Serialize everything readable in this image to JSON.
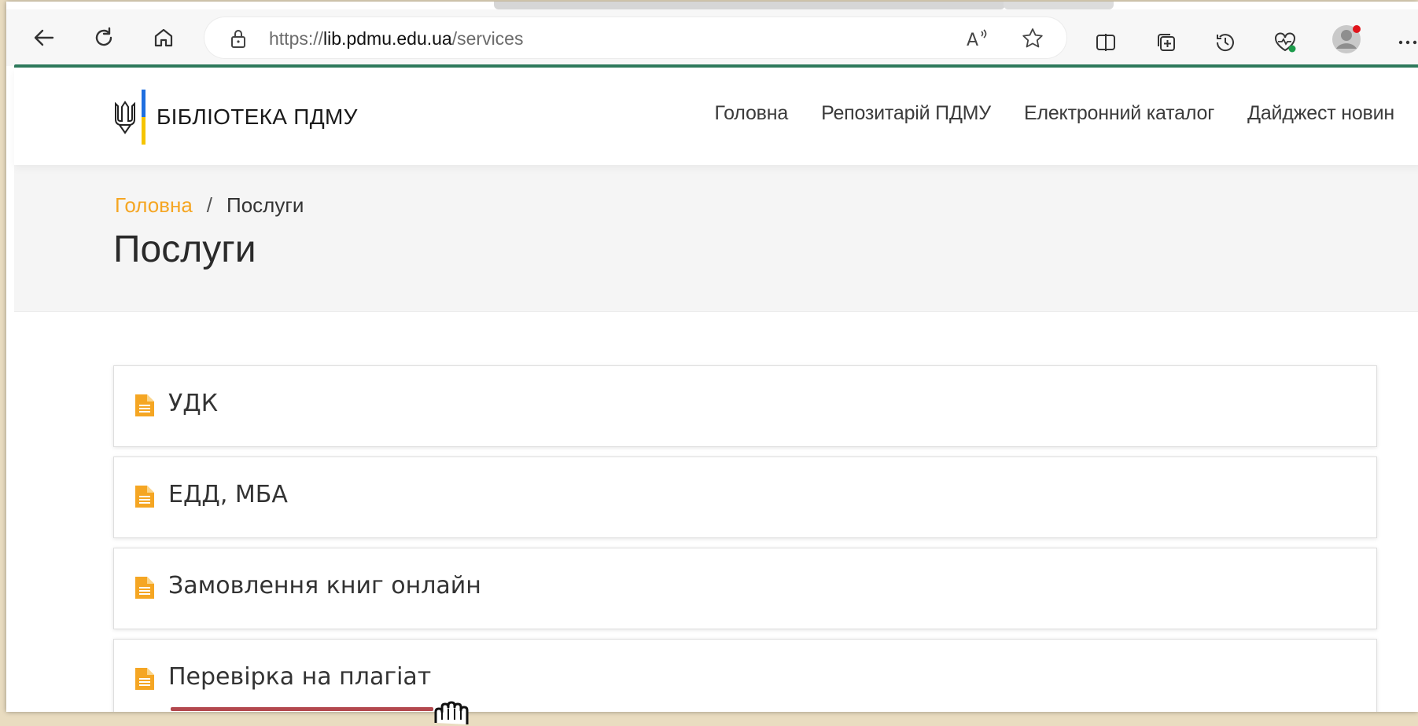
{
  "browser": {
    "url_scheme": "https://",
    "url_host": "lib.pdmu.edu.ua",
    "url_path": "/services",
    "icons": [
      "back-icon",
      "refresh-icon",
      "home-icon",
      "lock-icon",
      "read-aloud-icon",
      "favorite-star-icon",
      "split-screen-icon",
      "collections-icon",
      "history-icon",
      "browser-essentials-icon",
      "profile-avatar-icon",
      "more-menu-icon"
    ],
    "accent_color": "#2f7a5c"
  },
  "site": {
    "logo_text": "БІБЛІОТЕКА ПДМУ",
    "flag_colors": [
      "#1f6fe0",
      "#f5c400"
    ],
    "nav": [
      {
        "label": "Головна"
      },
      {
        "label": "Репозитарій ПДМУ"
      },
      {
        "label": "Електронний каталог"
      },
      {
        "label": "Дайджест новин"
      }
    ]
  },
  "breadcrumb": {
    "home": "Головна",
    "separator": "/",
    "current": "Послуги"
  },
  "page": {
    "title": "Послуги"
  },
  "services": [
    {
      "label": "УДК",
      "icon": "document-icon"
    },
    {
      "label": "ЕДД, МБА",
      "icon": "document-icon"
    },
    {
      "label": "Замовлення книг онлайн",
      "icon": "document-icon"
    },
    {
      "label": "Перевірка на плагіат",
      "icon": "document-icon",
      "highlighted": true
    }
  ],
  "colors": {
    "breadcrumb_link": "#f5a623",
    "service_icon": "#f5a623",
    "highlight_underline": "#b3484e"
  }
}
